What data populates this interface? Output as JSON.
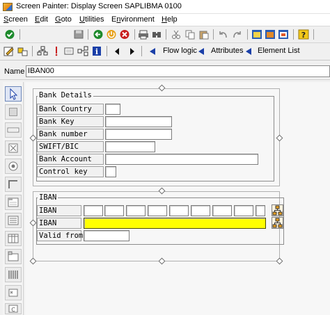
{
  "window": {
    "title": "Screen Painter: Display Screen SAPLIBMA 0100"
  },
  "menu": [
    {
      "label": "Screen",
      "ul": "S"
    },
    {
      "label": "Edit",
      "ul": "E"
    },
    {
      "label": "Goto",
      "ul": "G"
    },
    {
      "label": "Utilities",
      "ul": "U"
    },
    {
      "label": "Environment",
      "ul": "n"
    },
    {
      "label": "Help",
      "ul": "H"
    }
  ],
  "toolbar2": {
    "flow_logic": "Flow logic",
    "attributes": "Attributes",
    "element_list": "Element List"
  },
  "name_row": {
    "label": "Name",
    "value": "IBAN00"
  },
  "bank_details": {
    "title": "Bank Details",
    "fields": [
      {
        "label": "Bank Country"
      },
      {
        "label": "Bank Key"
      },
      {
        "label": "Bank number"
      },
      {
        "label": "SWIFT/BIC"
      },
      {
        "label": "Bank Account"
      },
      {
        "label": "Control key"
      }
    ]
  },
  "iban_block": {
    "title": "IBAN",
    "row1_label": "IBAN",
    "row2_label": "IBAN",
    "valid_from_label": "Valid from"
  },
  "colors": {
    "iban_highlight": "#ffff00",
    "flow_arrow": "#1a3fa8"
  }
}
